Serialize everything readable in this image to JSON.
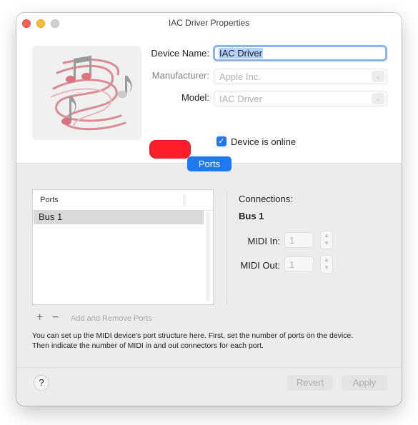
{
  "window": {
    "title": "IAC Driver Properties"
  },
  "device": {
    "name_label": "Device Name:",
    "name_value": "IAC Driver",
    "manufacturer_label": "Manufacturer:",
    "manufacturer_value": "Apple Inc.",
    "model_label": "Model:",
    "model_value": "IAC Driver",
    "online_label": "Device is online",
    "online_checked": true,
    "icon": "music-notes-icon"
  },
  "tabs": [
    {
      "label": "Ports",
      "selected": true
    }
  ],
  "ports": {
    "column_header": "Ports",
    "rows": [
      {
        "label": "Bus 1",
        "selected": true
      }
    ],
    "add_remove_label": "Add and Remove Ports",
    "plus_label": "+",
    "minus_label": "−"
  },
  "connections": {
    "title": "Connections:",
    "selected_port": "Bus 1",
    "midi_in_label": "MIDI In:",
    "midi_in_value": "1",
    "midi_out_label": "MIDI Out:",
    "midi_out_value": "1"
  },
  "help": {
    "text_line1": "You can set up the MIDI device's port structure here. First, set the number of ports on the device.",
    "text_line2": "Then indicate the number of MIDI in and out connectors for each port.",
    "question_label": "?"
  },
  "footer": {
    "revert_label": "Revert",
    "apply_label": "Apply"
  },
  "colors": {
    "accent": "#1f7af2",
    "device_color": "#ff1f2b"
  }
}
